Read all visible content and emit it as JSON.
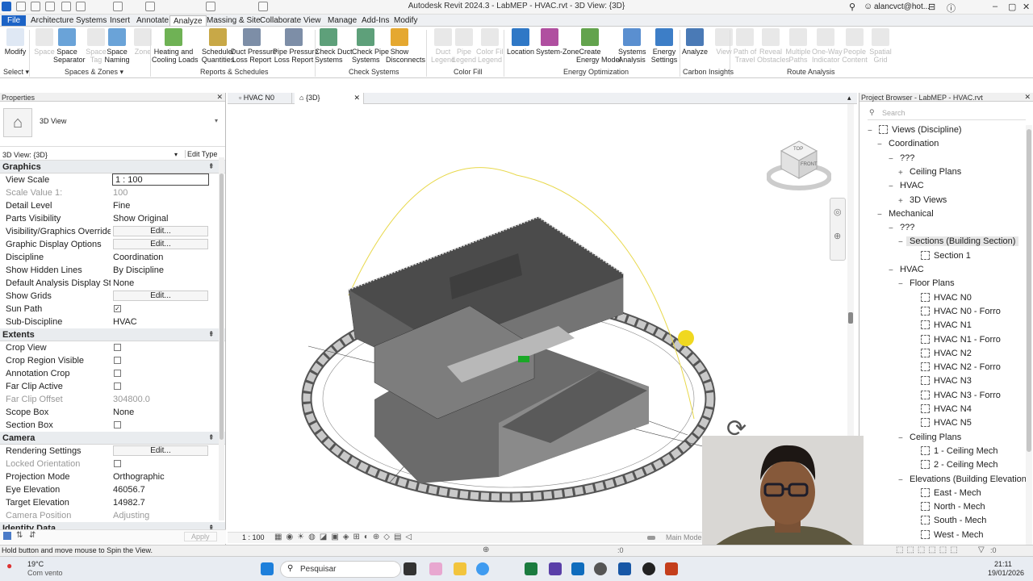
{
  "window": {
    "title": "Autodesk Revit 2024.3 - LabMEP - HVAC.rvt - 3D View: {3D}",
    "user": "alancvct@hot...",
    "min": "–",
    "max": "▢",
    "close": "✕"
  },
  "menu": [
    "File",
    "Architecture",
    "Systems",
    "Insert",
    "Annotate",
    "Analyze",
    "Massing & Site",
    "Collaborate",
    "View",
    "Manage",
    "Add-Ins",
    "Modify"
  ],
  "ribbon": {
    "buttons": [
      {
        "label": "Modify",
        "disabled": false
      },
      {
        "label": "Space",
        "disabled": true
      },
      {
        "label": "Space\nSeparator",
        "disabled": false
      },
      {
        "label": "Space\nTag",
        "disabled": true
      },
      {
        "label": "Space\nNaming",
        "disabled": false
      },
      {
        "label": "Zone",
        "disabled": true
      },
      {
        "label": "Heating and\nCooling Loads",
        "disabled": false
      },
      {
        "label": "Schedule/\nQuantities",
        "disabled": false
      },
      {
        "label": "Duct Pressure\nLoss Report",
        "disabled": false
      },
      {
        "label": "Pipe Pressure\nLoss Report",
        "disabled": false
      },
      {
        "label": "Check Duct\nSystems",
        "disabled": false
      },
      {
        "label": "Check Pipe\nSystems",
        "disabled": false
      },
      {
        "label": "Show\nDisconnects",
        "disabled": false
      },
      {
        "label": "Duct\nLegend",
        "disabled": true
      },
      {
        "label": "Pipe\nLegend",
        "disabled": true
      },
      {
        "label": "Color Fill\nLegend",
        "disabled": true
      },
      {
        "label": "Location",
        "disabled": false
      },
      {
        "label": "System-Zone",
        "disabled": false
      },
      {
        "label": "Create\nEnergy Model",
        "disabled": false
      },
      {
        "label": "Systems\nAnalysis",
        "disabled": false
      },
      {
        "label": "Energy\nSettings",
        "disabled": false
      },
      {
        "label": "Analyze",
        "disabled": false
      },
      {
        "label": "View",
        "disabled": true
      },
      {
        "label": "Path of\nTravel",
        "disabled": true
      },
      {
        "label": "Reveal\nObstacles",
        "disabled": true
      },
      {
        "label": "Multiple\nPaths",
        "disabled": true
      },
      {
        "label": "One-Way\nIndicator",
        "disabled": true
      },
      {
        "label": "People\nContent",
        "disabled": true
      },
      {
        "label": "Spatial\nGrid",
        "disabled": true
      }
    ],
    "groups": [
      "Select ▾",
      "Spaces & Zones ▾",
      "Reports & Schedules",
      "Check Systems",
      "Color Fill",
      "Energy Optimization",
      "Carbon Insights",
      "Route Analysis"
    ]
  },
  "properties": {
    "title": "Properties",
    "type_name": "3D View",
    "selector": "3D View: {3D}",
    "edit_type": "Edit Type",
    "sections": [
      {
        "name": "Graphics",
        "rows": [
          {
            "k": "View Scale",
            "v": "1 : 100",
            "kind": "input"
          },
          {
            "k": "Scale Value    1:",
            "v": "100",
            "kind": "ro"
          },
          {
            "k": "Detail Level",
            "v": "Fine"
          },
          {
            "k": "Parts Visibility",
            "v": "Show Original"
          },
          {
            "k": "Visibility/Graphics Overrides",
            "v": "Edit...",
            "kind": "btn"
          },
          {
            "k": "Graphic Display Options",
            "v": "Edit...",
            "kind": "btn"
          },
          {
            "k": "Discipline",
            "v": "Coordination"
          },
          {
            "k": "Show Hidden Lines",
            "v": "By Discipline"
          },
          {
            "k": "Default Analysis Display Style",
            "v": "None"
          },
          {
            "k": "Show Grids",
            "v": "Edit...",
            "kind": "btn"
          },
          {
            "k": "Sun Path",
            "v": "✓",
            "kind": "chk"
          },
          {
            "k": "Sub-Discipline",
            "v": "HVAC"
          }
        ]
      },
      {
        "name": "Extents",
        "rows": [
          {
            "k": "Crop View",
            "v": "",
            "kind": "chk"
          },
          {
            "k": "Crop Region Visible",
            "v": "",
            "kind": "chk"
          },
          {
            "k": "Annotation Crop",
            "v": "",
            "kind": "chk"
          },
          {
            "k": "Far Clip Active",
            "v": "",
            "kind": "chk"
          },
          {
            "k": "Far Clip Offset",
            "v": "304800.0",
            "kind": "ro"
          },
          {
            "k": "Scope Box",
            "v": "None"
          },
          {
            "k": "Section Box",
            "v": "",
            "kind": "chk"
          }
        ]
      },
      {
        "name": "Camera",
        "rows": [
          {
            "k": "Rendering Settings",
            "v": "Edit...",
            "kind": "btn"
          },
          {
            "k": "Locked Orientation",
            "v": "",
            "kind": "chkro"
          },
          {
            "k": "Projection Mode",
            "v": "Orthographic"
          },
          {
            "k": "Eye Elevation",
            "v": "46056.7"
          },
          {
            "k": "Target Elevation",
            "v": "14982.7"
          },
          {
            "k": "Camera Position",
            "v": "Adjusting",
            "kind": "ro"
          }
        ]
      },
      {
        "name": "Identity Data",
        "rows": []
      }
    ],
    "apply": "Apply"
  },
  "tabs": [
    {
      "label": "HVAC N0"
    },
    {
      "label": "{3D}"
    }
  ],
  "viewbar": {
    "scale": "1 : 100",
    "model": "Main Model"
  },
  "browser": {
    "title": "Project Browser - LabMEP - HVAC.rvt",
    "search": "Search",
    "nodes": [
      {
        "label": "Views (Discipline)",
        "lvl": 0,
        "tog": "−",
        "icon": "views"
      },
      {
        "label": "Coordination",
        "lvl": 1,
        "tog": "−"
      },
      {
        "label": "???",
        "lvl": 2,
        "tog": "−"
      },
      {
        "label": "Ceiling Plans",
        "lvl": 3,
        "tog": "+"
      },
      {
        "label": "HVAC",
        "lvl": 2,
        "tog": "−"
      },
      {
        "label": "3D Views",
        "lvl": 3,
        "tog": "+"
      },
      {
        "label": "Mechanical",
        "lvl": 1,
        "tog": "−"
      },
      {
        "label": "???",
        "lvl": 2,
        "tog": "−"
      },
      {
        "label": "Sections (Building Section)",
        "lvl": 3,
        "tog": "−",
        "sel": true
      },
      {
        "label": "Section 1",
        "lvl": 4,
        "icon": "view"
      },
      {
        "label": "HVAC",
        "lvl": 2,
        "tog": "−"
      },
      {
        "label": "Floor Plans",
        "lvl": 3,
        "tog": "−"
      },
      {
        "label": "HVAC N0",
        "lvl": 4,
        "icon": "view"
      },
      {
        "label": "HVAC N0 - Forro",
        "lvl": 4,
        "icon": "view"
      },
      {
        "label": "HVAC N1",
        "lvl": 4,
        "icon": "view"
      },
      {
        "label": "HVAC N1 - Forro",
        "lvl": 4,
        "icon": "view"
      },
      {
        "label": "HVAC N2",
        "lvl": 4,
        "icon": "view"
      },
      {
        "label": "HVAC N2 - Forro",
        "lvl": 4,
        "icon": "view"
      },
      {
        "label": "HVAC N3",
        "lvl": 4,
        "icon": "view"
      },
      {
        "label": "HVAC N3 - Forro",
        "lvl": 4,
        "icon": "view"
      },
      {
        "label": "HVAC N4",
        "lvl": 4,
        "icon": "view"
      },
      {
        "label": "HVAC N5",
        "lvl": 4,
        "icon": "view"
      },
      {
        "label": "Ceiling Plans",
        "lvl": 3,
        "tog": "−"
      },
      {
        "label": "1 - Ceiling Mech",
        "lvl": 4,
        "icon": "view"
      },
      {
        "label": "2 - Ceiling Mech",
        "lvl": 4,
        "icon": "view"
      },
      {
        "label": "Elevations (Building Elevation)",
        "lvl": 3,
        "tog": "−"
      },
      {
        "label": "East - Mech",
        "lvl": 4,
        "icon": "view"
      },
      {
        "label": "North - Mech",
        "lvl": 4,
        "icon": "view"
      },
      {
        "label": "South - Mech",
        "lvl": 4,
        "icon": "view"
      },
      {
        "label": "West - Mech",
        "lvl": 4,
        "icon": "view"
      }
    ]
  },
  "viewcube": {
    "top": "TOP",
    "front": "FRONT"
  },
  "status": {
    "text": "Hold button and move mouse to Spin the View.",
    "zero1": ":0",
    "zero2": ":0"
  },
  "taskbar": {
    "temp": "19°C",
    "weather": "Com vento",
    "search": "Pesquisar",
    "time": "21:11",
    "date": "19/01/2026"
  }
}
